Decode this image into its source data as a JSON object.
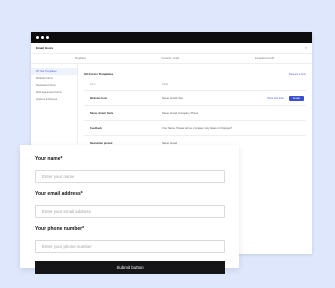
{
  "app": {
    "title": "Email Hosts",
    "close_glyph": "×",
    "tabs": [
      "Templates",
      "Contacts / Leads",
      "Integrations & API"
    ],
    "sidebar": [
      {
        "label": "All Your Templates",
        "active": true
      },
      {
        "label": "Website Forms",
        "active": false
      },
      {
        "label": "Newsletter Forms",
        "active": false
      },
      {
        "label": "Web Agreement Forms",
        "active": false
      },
      {
        "label": "Quizzes & Surveys",
        "active": false
      }
    ],
    "main": {
      "heading": "All Forms Templates",
      "action": "Request a form",
      "columns": [
        "Form",
        "Fields"
      ],
      "rows": [
        {
          "name": "Website Form",
          "fields": "Name, Email, Site"
        },
        {
          "name": "Name, Email, Suite",
          "fields": "Name, Email, Company, Phone"
        },
        {
          "name": "Feedback",
          "fields": "Your Name, Please tell us, 2 Answer, Any Ideas or Changes?"
        },
        {
          "name": "Newsletter pinned",
          "fields": "Name, Email"
        }
      ],
      "row_link": "Show help links",
      "row_button": "Create"
    }
  },
  "form": {
    "name_label": "Your name*",
    "name_placeholder": "Enter your name",
    "email_label": "Your email address*",
    "email_placeholder": "Enter your email address",
    "phone_label": "Your phone number*",
    "phone_placeholder": "Enter your phone number",
    "submit_label": "Submit button"
  },
  "colors": {
    "page_background": "#dfe7fd",
    "title_bar": "#0c0c0f",
    "accent": "#3b4fcf",
    "submit_button": "#151517"
  }
}
